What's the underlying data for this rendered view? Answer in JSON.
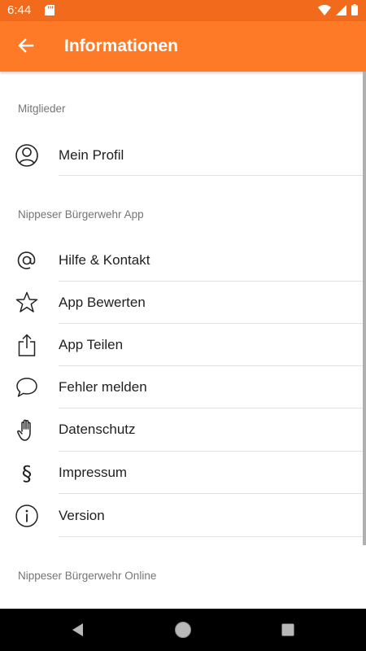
{
  "status": {
    "time": "6:44"
  },
  "appbar": {
    "title": "Informationen",
    "back_icon": "arrow-back-icon"
  },
  "sections": [
    {
      "header": "Mitglieder"
    },
    {
      "header": "Nippeser Bürgerwehr App"
    },
    {
      "header": "Nippeser Bürgerwehr Online"
    }
  ],
  "members": {
    "profile_label": "Mein Profil",
    "profile_icon": "user-circle-icon"
  },
  "app_items": [
    {
      "label": "Hilfe & Kontakt",
      "icon": "at-sign-icon"
    },
    {
      "label": "App Bewerten",
      "icon": "star-icon"
    },
    {
      "label": "App Teilen",
      "icon": "share-icon"
    },
    {
      "label": "Fehler melden",
      "icon": "speech-bubble-icon"
    },
    {
      "label": "Datenschutz",
      "icon": "hand-icon"
    },
    {
      "label": "Impressum",
      "icon": "section-sign-icon"
    },
    {
      "label": "Version",
      "icon": "info-icon"
    }
  ],
  "colors": {
    "appbar": "#ff7a27",
    "statusbar": "#f26a1b"
  }
}
